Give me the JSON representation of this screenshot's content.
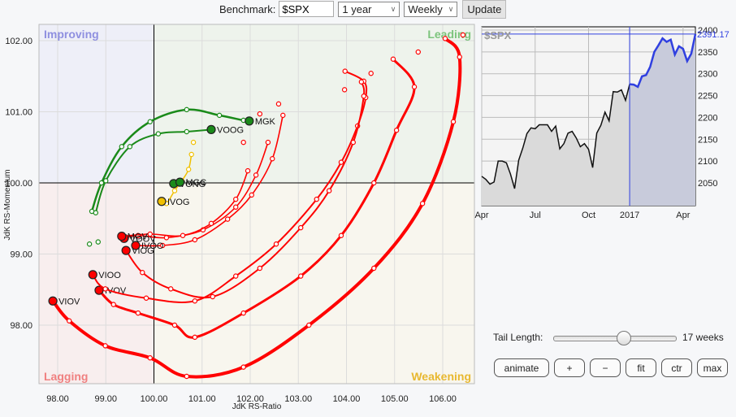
{
  "toolbar": {
    "benchmark_label": "Benchmark:",
    "benchmark_value": "$SPX",
    "period": "1 year",
    "frequency": "Weekly",
    "update_label": "Update"
  },
  "chart_data": {
    "type": "scatter",
    "title": "Relative Rotation Graph",
    "xlabel": "JdK RS-Ratio",
    "ylabel": "JdK RS-Momentum",
    "xlim": [
      97.6,
      106.6
    ],
    "ylim": [
      97.25,
      102.25
    ],
    "xticks": [
      "98.00",
      "99.00",
      "100.00",
      "101.00",
      "102.00",
      "103.00",
      "104.00",
      "105.00",
      "106.00"
    ],
    "yticks": [
      "102.00",
      "101.00",
      "100.00",
      "99.00",
      "98.00"
    ],
    "quadrants": {
      "improving": "Improving",
      "leading": "Leading",
      "lagging": "Lagging",
      "weakening": "Weakening"
    },
    "series": [
      {
        "name": "VIOV",
        "color": "#ff0000",
        "width": 4,
        "tail": [
          [
            106.42,
            102.08
          ],
          [
            106.05,
            102.03
          ],
          [
            106.35,
            101.77
          ],
          [
            106.22,
            100.86
          ],
          [
            105.58,
            99.71
          ],
          [
            104.57,
            98.8
          ],
          [
            103.22,
            98.0
          ],
          [
            101.86,
            97.41
          ],
          [
            100.68,
            97.28
          ],
          [
            99.92,
            97.54
          ],
          [
            98.99,
            97.71
          ],
          [
            98.24,
            98.06
          ],
          [
            97.9,
            98.34
          ]
        ]
      },
      {
        "name": "IVOV",
        "color": "#ff0000",
        "width": 3,
        "tail": [
          [
            105.49,
            101.84
          ],
          [
            104.97,
            101.74
          ],
          [
            105.41,
            101.35
          ],
          [
            105.04,
            100.74
          ],
          [
            104.57,
            100.0
          ],
          [
            103.89,
            99.26
          ],
          [
            103.05,
            98.69
          ],
          [
            101.86,
            98.17
          ],
          [
            100.85,
            97.83
          ],
          [
            100.43,
            98.0
          ],
          [
            99.67,
            98.17
          ],
          [
            99.16,
            98.29
          ],
          [
            98.86,
            98.49
          ]
        ]
      },
      {
        "name": "VIOO",
        "color": "#ff0000",
        "width": 2,
        "tail": [
          [
            104.51,
            101.54
          ],
          [
            103.97,
            101.57
          ],
          [
            104.36,
            101.43
          ],
          [
            104.4,
            101.2
          ],
          [
            104.23,
            100.8
          ],
          [
            103.89,
            100.29
          ],
          [
            103.38,
            99.77
          ],
          [
            102.54,
            99.14
          ],
          [
            101.7,
            98.69
          ],
          [
            100.85,
            98.34
          ],
          [
            99.84,
            98.38
          ],
          [
            98.99,
            98.51
          ],
          [
            98.73,
            98.71
          ]
        ]
      },
      {
        "name": "VIOG",
        "color": "#ff0000",
        "width": 2,
        "tail": [
          [
            103.96,
            101.31
          ],
          [
            104.31,
            101.42
          ],
          [
            104.36,
            101.22
          ],
          [
            104.14,
            100.57
          ],
          [
            103.64,
            99.89
          ],
          [
            103.05,
            99.37
          ],
          [
            102.2,
            98.8
          ],
          [
            101.22,
            98.4
          ],
          [
            100.35,
            98.51
          ],
          [
            99.76,
            98.74
          ],
          [
            99.42,
            99.05
          ]
        ]
      },
      {
        "name": "IVOO",
        "color": "#ff0000",
        "width": 1.6,
        "tail": [
          [
            102.59,
            101.11
          ],
          [
            102.68,
            100.95
          ],
          [
            102.46,
            100.34
          ],
          [
            102.03,
            99.83
          ],
          [
            101.53,
            99.49
          ],
          [
            100.85,
            99.2
          ],
          [
            100.18,
            99.12
          ],
          [
            99.62,
            99.12
          ]
        ]
      },
      {
        "name": "VOOV",
        "color": "#ff0000",
        "width": 1.6,
        "tail": [
          [
            102.2,
            100.97
          ],
          [
            102.37,
            100.57
          ],
          [
            102.12,
            100.11
          ],
          [
            101.7,
            99.66
          ],
          [
            101.02,
            99.34
          ],
          [
            100.26,
            99.23
          ],
          [
            99.67,
            99.26
          ],
          [
            99.38,
            99.22
          ]
        ]
      },
      {
        "name": "MGV",
        "color": "#ff0000",
        "width": 1.6,
        "tail": [
          [
            101.86,
            100.57
          ],
          [
            101.95,
            100.17
          ],
          [
            101.7,
            99.77
          ],
          [
            101.19,
            99.43
          ],
          [
            100.6,
            99.26
          ],
          [
            99.92,
            99.28
          ],
          [
            99.33,
            99.25
          ]
        ]
      },
      {
        "name": "MGK",
        "color": "#1a8a1a",
        "width": 2.5,
        "tail": [
          [
            98.66,
            99.14
          ],
          [
            98.71,
            99.6
          ],
          [
            98.91,
            100.0
          ],
          [
            99.33,
            100.51
          ],
          [
            99.92,
            100.86
          ],
          [
            100.68,
            101.03
          ],
          [
            101.36,
            100.95
          ],
          [
            101.86,
            100.88
          ],
          [
            101.98,
            100.87
          ]
        ]
      },
      {
        "name": "VOOG",
        "color": "#1a8a1a",
        "width": 2,
        "tail": [
          [
            98.84,
            99.17
          ],
          [
            98.79,
            99.58
          ],
          [
            99.0,
            100.03
          ],
          [
            99.5,
            100.51
          ],
          [
            100.09,
            100.69
          ],
          [
            100.68,
            100.72
          ],
          [
            101.19,
            100.75
          ]
        ]
      },
      {
        "name": "IVOG",
        "color": "#f0c000",
        "width": 1.5,
        "tail": [
          [
            100.82,
            100.57
          ],
          [
            100.78,
            100.4
          ],
          [
            100.72,
            100.19
          ],
          [
            100.58,
            100.03
          ],
          [
            100.43,
            99.89
          ],
          [
            100.26,
            99.71
          ],
          [
            100.16,
            99.74
          ]
        ]
      },
      {
        "name": "VONG",
        "color": "#1a8a1a",
        "width": 2,
        "tail": [
          [
            100.41,
            99.99
          ]
        ]
      },
      {
        "name": "MGC",
        "color": "#1a8a1a",
        "width": 2,
        "tail": [
          [
            100.54,
            100.01
          ]
        ]
      }
    ]
  },
  "benchmark_chart": {
    "title": "$SPX",
    "last_value": "2391.17",
    "yticks": [
      "2400",
      "2350",
      "2300",
      "2250",
      "2200",
      "2150",
      "2100",
      "2050"
    ],
    "xticks": [
      {
        "label": "Apr",
        "index": 0
      },
      {
        "label": "Jul",
        "index": 13
      },
      {
        "label": "Oct",
        "index": 26
      },
      {
        "label": "2017",
        "index": 36
      },
      {
        "label": "Apr",
        "index": 49
      }
    ],
    "highlight_start_index": 36,
    "values": [
      2065,
      2058,
      2047,
      2052,
      2100,
      2100,
      2096,
      2070,
      2037,
      2102,
      2130,
      2163,
      2176,
      2174,
      2183,
      2183,
      2183,
      2168,
      2180,
      2128,
      2140,
      2164,
      2168,
      2153,
      2133,
      2140,
      2127,
      2085,
      2164,
      2182,
      2212,
      2192,
      2259,
      2258,
      2263,
      2239,
      2276,
      2275,
      2270,
      2294,
      2297,
      2316,
      2350,
      2365,
      2381,
      2373,
      2378,
      2344,
      2363,
      2357,
      2329,
      2346,
      2391
    ]
  },
  "controls": {
    "tail_label": "Tail Length:",
    "tail_value": 17,
    "tail_max": 30,
    "tail_text": "17 weeks",
    "buttons": [
      "animate",
      "+",
      "−",
      "fit",
      "ctr",
      "max"
    ]
  }
}
